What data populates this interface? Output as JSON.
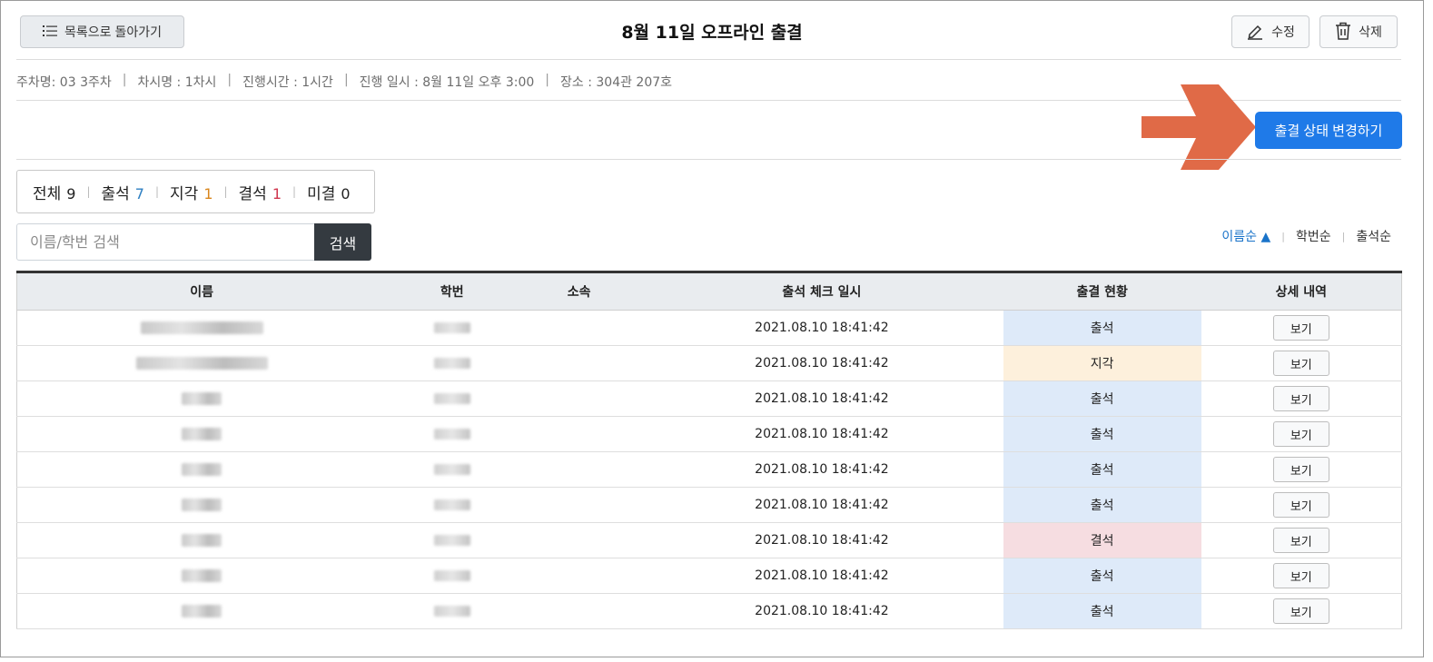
{
  "header": {
    "back_label": "목록으로 돌아가기",
    "title": "8월 11일 오프라인 출결",
    "edit_label": "수정",
    "delete_label": "삭제"
  },
  "meta": [
    "주차명: 03 3주차",
    "차시명 : 1차시",
    "진행시간 : 1시간",
    "진행 일시 : 8월 11일 오후 3:00",
    "장소 : 304관 207호"
  ],
  "meta_separator": "|",
  "change_status_label": "출결 상태 변경하기",
  "counts": {
    "separator": "|",
    "items": [
      {
        "label": "전체",
        "value": "9",
        "color": "#222222"
      },
      {
        "label": "출석",
        "value": "7",
        "color": "#2d7fc2"
      },
      {
        "label": "지각",
        "value": "1",
        "color": "#d9861c"
      },
      {
        "label": "결석",
        "value": "1",
        "color": "#d0364e"
      },
      {
        "label": "미결",
        "value": "0",
        "color": "#222222"
      }
    ]
  },
  "search": {
    "placeholder": "이름/학번 검색",
    "button_label": "검색"
  },
  "sort": {
    "options": [
      "이름순 ▲",
      "학번순",
      "출석순"
    ],
    "active_index": 0,
    "separator": "|"
  },
  "table": {
    "columns": [
      "이름",
      "학번",
      "소속",
      "출석 체크 일시",
      "출결 현황",
      "상세 내역"
    ],
    "rows": [
      {
        "affiliation": "",
        "checked_at": "2021.08.10 18:41:42",
        "status": "출석",
        "status_type": "present",
        "detail": "보기"
      },
      {
        "affiliation": "",
        "checked_at": "2021.08.10 18:41:42",
        "status": "지각",
        "status_type": "late",
        "detail": "보기"
      },
      {
        "affiliation": "",
        "checked_at": "2021.08.10 18:41:42",
        "status": "출석",
        "status_type": "present",
        "detail": "보기"
      },
      {
        "affiliation": "",
        "checked_at": "2021.08.10 18:41:42",
        "status": "출석",
        "status_type": "present",
        "detail": "보기"
      },
      {
        "affiliation": "",
        "checked_at": "2021.08.10 18:41:42",
        "status": "출석",
        "status_type": "present",
        "detail": "보기"
      },
      {
        "affiliation": "",
        "checked_at": "2021.08.10 18:41:42",
        "status": "출석",
        "status_type": "present",
        "detail": "보기"
      },
      {
        "affiliation": "",
        "checked_at": "2021.08.10 18:41:42",
        "status": "결석",
        "status_type": "absent",
        "detail": "보기"
      },
      {
        "affiliation": "",
        "checked_at": "2021.08.10 18:41:42",
        "status": "출석",
        "status_type": "present",
        "detail": "보기"
      },
      {
        "affiliation": "",
        "checked_at": "2021.08.10 18:41:42",
        "status": "출석",
        "status_type": "present",
        "detail": "보기"
      }
    ]
  },
  "colors": {
    "primary": "#1f7ae8",
    "arrow": "#e06a47",
    "dark_button": "#343a40"
  }
}
